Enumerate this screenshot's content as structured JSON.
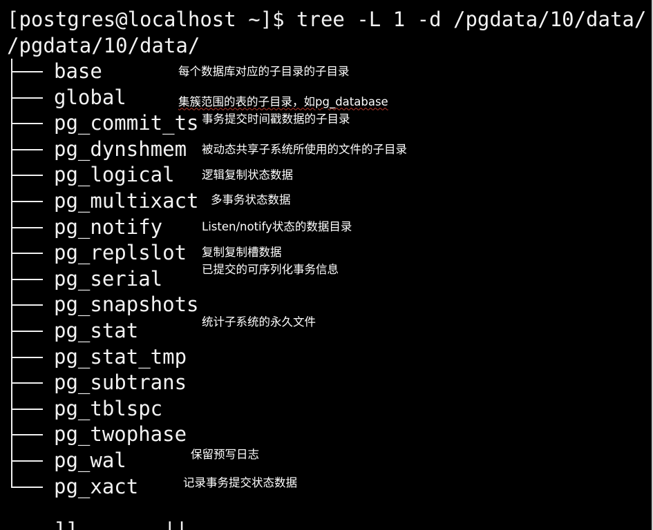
{
  "terminal": {
    "prompt": "[postgres@localhost ~]$ tree -L 1 -d /pgdata/10/data/",
    "root_path": "/pgdata/10/data/",
    "partial_next_line": "    ll       ||",
    "rows": [
      {
        "name": "base",
        "note": "每个数据库对应的子目录的子目录"
      },
      {
        "name": "global",
        "note": "集簇范围的表的子目录，如pg_database"
      },
      {
        "name": "pg_commit_ts",
        "note": "事务提交时间戳数据的子目录"
      },
      {
        "name": "pg_dynshmem",
        "note": "被动态共享子系统所使用的文件的子目录"
      },
      {
        "name": "pg_logical",
        "note": "逻辑复制状态数据"
      },
      {
        "name": "pg_multixact",
        "note": "多事务状态数据"
      },
      {
        "name": "pg_notify",
        "note": "Listen/notify状态的数据目录"
      },
      {
        "name": "pg_replslot",
        "note": "复制复制槽数据"
      },
      {
        "name": "pg_serial",
        "note": "已提交的可序列化事务信息"
      },
      {
        "name": "pg_snapshots",
        "note": ""
      },
      {
        "name": "pg_stat",
        "note": "统计子系统的永久文件"
      },
      {
        "name": "pg_stat_tmp",
        "note": ""
      },
      {
        "name": "pg_subtrans",
        "note": ""
      },
      {
        "name": "pg_tblspc",
        "note": ""
      },
      {
        "name": "pg_twophase",
        "note": ""
      },
      {
        "name": "pg_wal",
        "note": "保留预写日志"
      },
      {
        "name": "pg_xact",
        "note": "记录事务提交状态数据"
      }
    ]
  },
  "colors": {
    "background": "#000000",
    "text": "#f2f2f2",
    "spell_underline": "#c0392b"
  }
}
